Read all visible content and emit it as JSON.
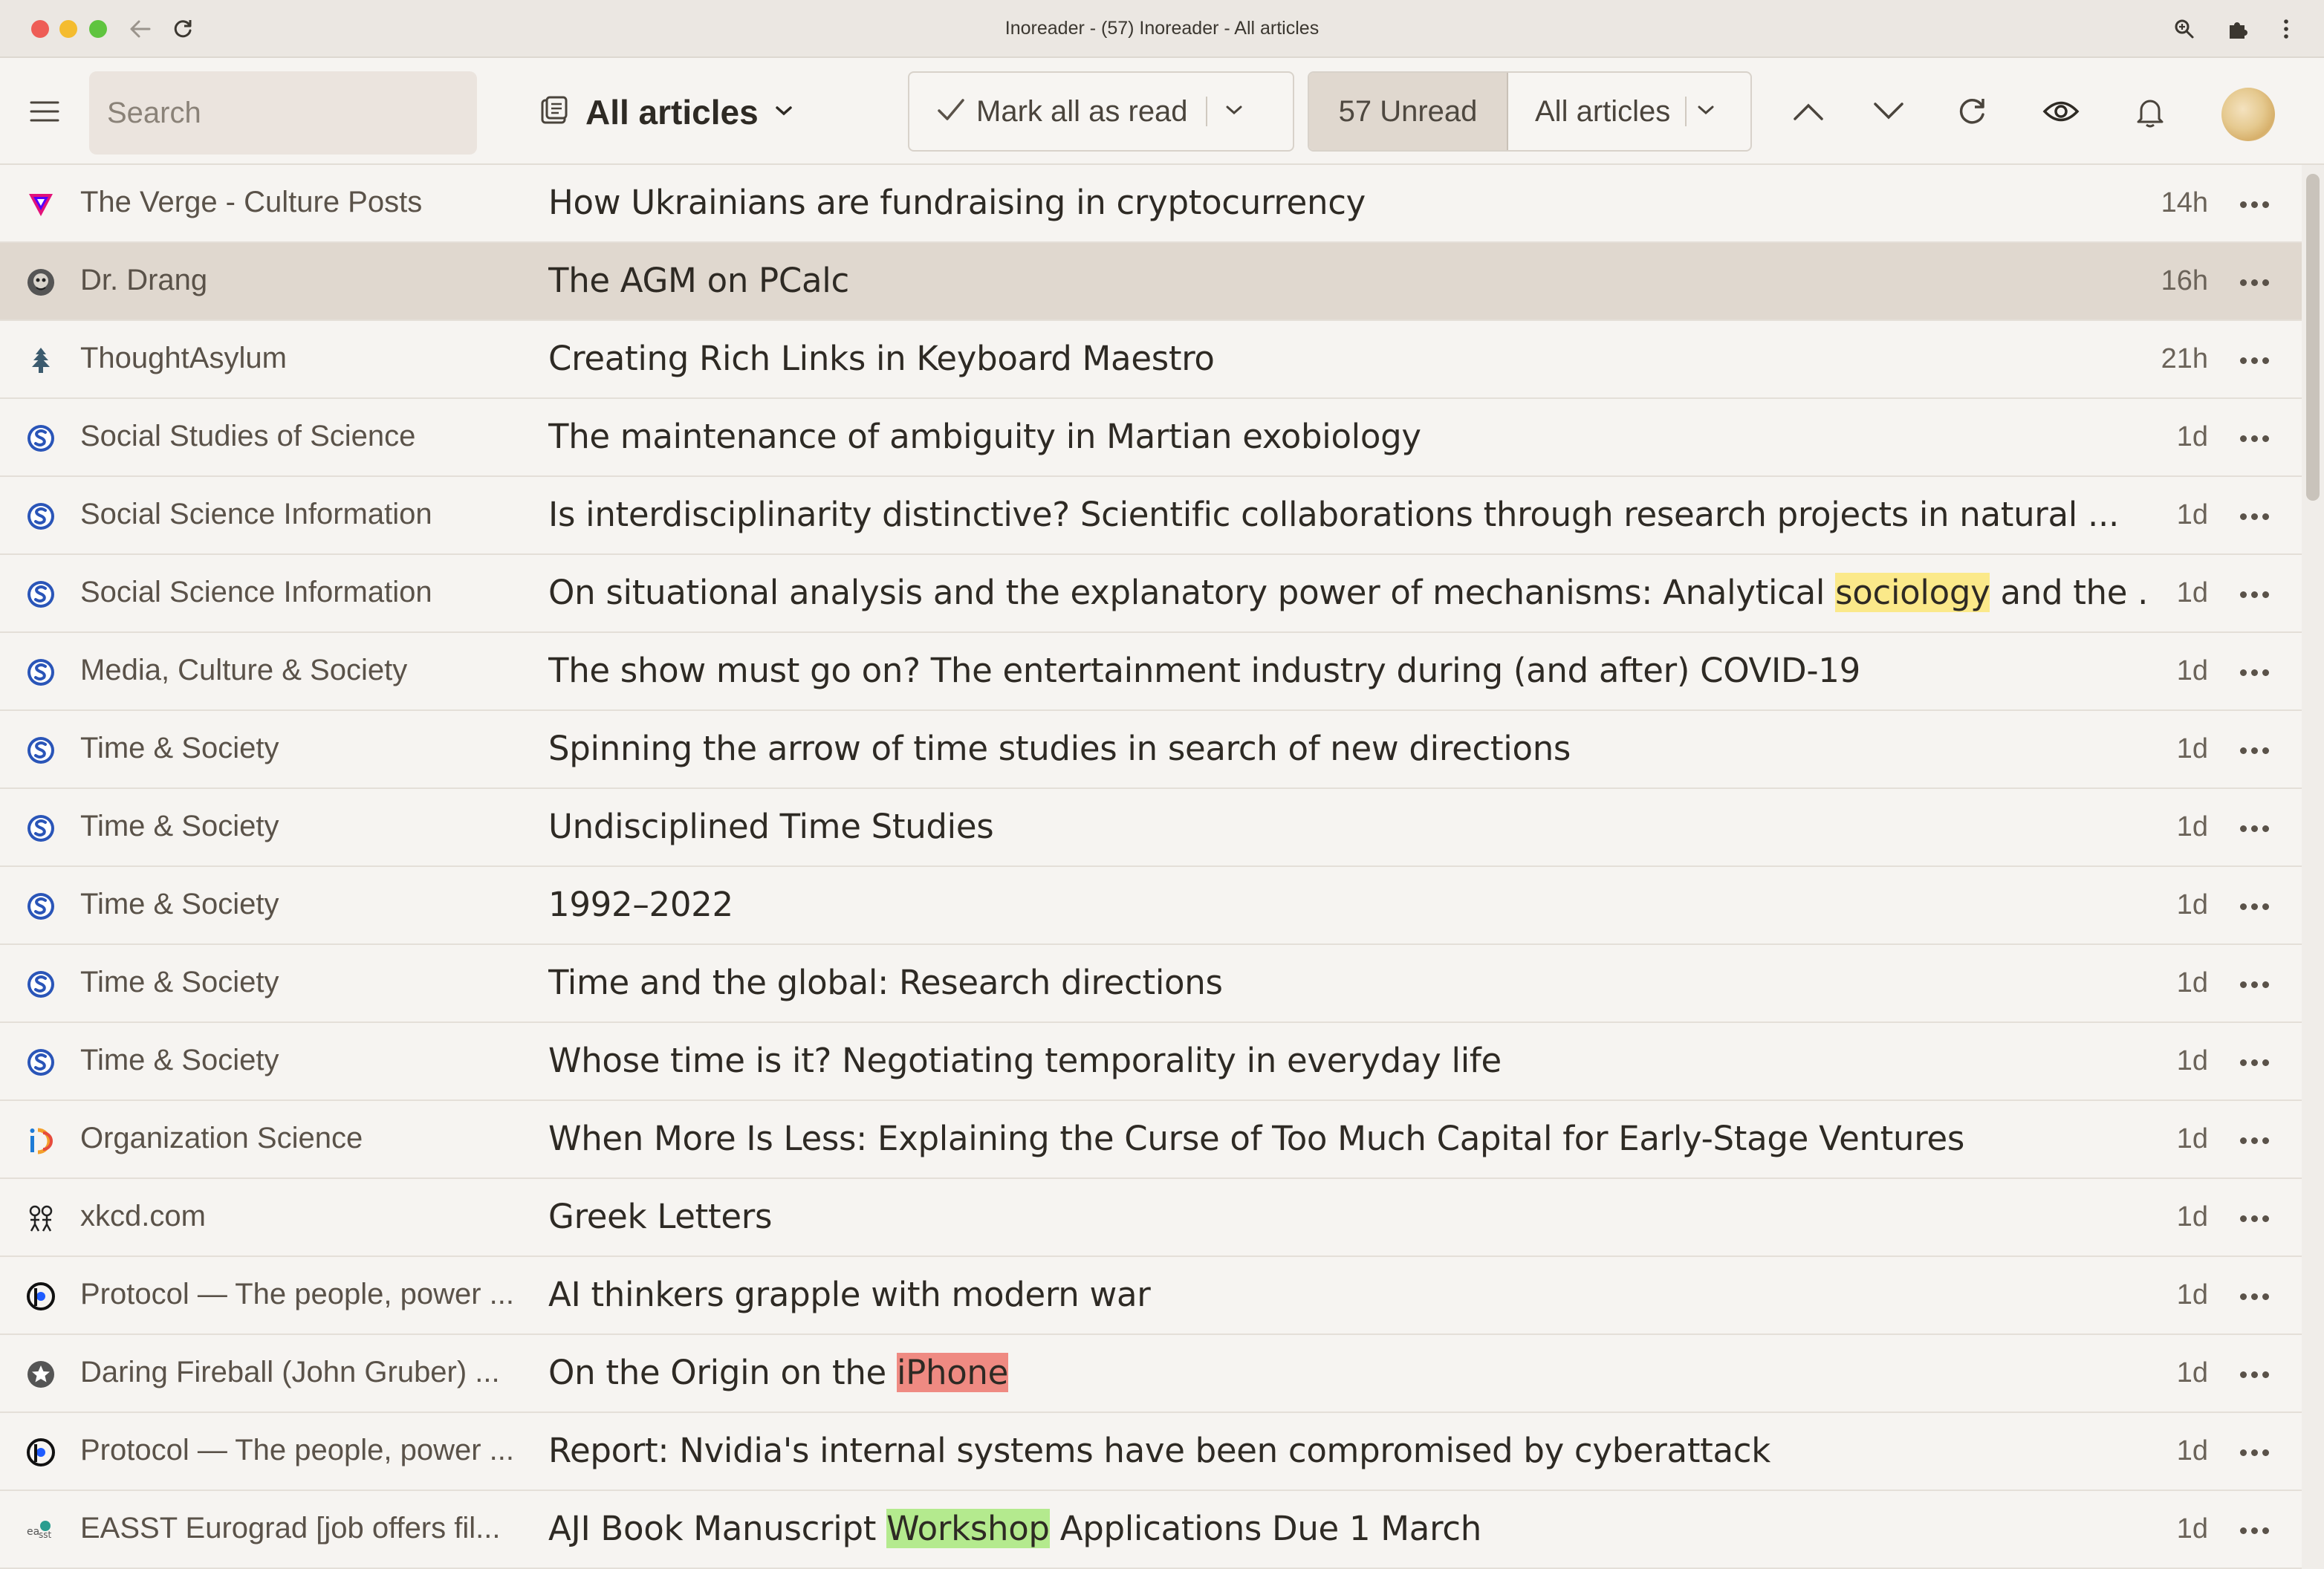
{
  "window": {
    "title": "Inoreader - (57) Inoreader - All articles"
  },
  "toolbar": {
    "search_placeholder": "Search",
    "view_title": "All articles",
    "mark_all_read": "Mark all as read",
    "unread_count": "57 Unread",
    "filter": "All articles"
  },
  "icons": {
    "menu": "hamburger-icon",
    "view": "article-list-icon",
    "prev": "chevron-up-icon",
    "next": "chevron-down-icon",
    "refresh": "refresh-icon",
    "visibility": "eye-icon",
    "notifications": "bell-icon"
  },
  "colors": {
    "selected_row": "#e0d8cf",
    "highlight_yellow": "#fbe98a",
    "highlight_red": "#ef8a82",
    "highlight_green": "#b4ea8e"
  },
  "articles": [
    {
      "feed": "The Verge - Culture Posts",
      "icon": "verge-icon",
      "pre": "How Ukrainians are fundraising in cryptocurrency",
      "hl": "",
      "post": "",
      "age": "14h",
      "selected": false
    },
    {
      "feed": "Dr. Drang",
      "icon": "drang-icon",
      "pre": "The AGM on PCalc",
      "hl": "",
      "post": "",
      "age": "16h",
      "selected": true
    },
    {
      "feed": "ThoughtAsylum",
      "icon": "thoughtasylum-icon",
      "pre": "Creating Rich Links in Keyboard Maestro",
      "hl": "",
      "post": "",
      "age": "21h",
      "selected": false
    },
    {
      "feed": "Social Studies of Science",
      "icon": "sage-icon",
      "pre": "The maintenance of ambiguity in Martian exobiology",
      "hl": "",
      "post": "",
      "age": "1d",
      "selected": false
    },
    {
      "feed": "Social Science Information",
      "icon": "sage-icon",
      "pre": "Is interdisciplinarity distinctive? Scientific collaborations through research projects in natural ...",
      "hl": "",
      "post": "",
      "age": "1d",
      "selected": false
    },
    {
      "feed": "Social Science Information",
      "icon": "sage-icon",
      "pre": "On situational analysis and the explanatory power of mechanisms: Analytical ",
      "hl": "sociology",
      "hl_color": "yellow",
      "post": " and the ...",
      "age": "1d",
      "selected": false
    },
    {
      "feed": "Media, Culture & Society",
      "icon": "sage-icon",
      "pre": "The show must go on? The entertainment industry during (and after) COVID-19",
      "hl": "",
      "post": "",
      "age": "1d",
      "selected": false
    },
    {
      "feed": "Time & Society",
      "icon": "sage-icon",
      "pre": "Spinning the arrow of time studies in search of new directions",
      "hl": "",
      "post": "",
      "age": "1d",
      "selected": false
    },
    {
      "feed": "Time & Society",
      "icon": "sage-icon",
      "pre": "Undisciplined Time Studies",
      "hl": "",
      "post": "",
      "age": "1d",
      "selected": false
    },
    {
      "feed": "Time & Society",
      "icon": "sage-icon",
      "pre": "1992–2022",
      "hl": "",
      "post": "",
      "age": "1d",
      "selected": false
    },
    {
      "feed": "Time & Society",
      "icon": "sage-icon",
      "pre": "Time and the global: Research directions",
      "hl": "",
      "post": "",
      "age": "1d",
      "selected": false
    },
    {
      "feed": "Time & Society",
      "icon": "sage-icon",
      "pre": "Whose time is it? Negotiating temporality in everyday life",
      "hl": "",
      "post": "",
      "age": "1d",
      "selected": false
    },
    {
      "feed": "Organization Science",
      "icon": "informs-icon",
      "pre": "When More Is Less: Explaining the Curse of Too Much Capital for Early-Stage Ventures",
      "hl": "",
      "post": "",
      "age": "1d",
      "selected": false
    },
    {
      "feed": "xkcd.com",
      "icon": "xkcd-icon",
      "pre": "Greek Letters",
      "hl": "",
      "post": "",
      "age": "1d",
      "selected": false
    },
    {
      "feed": "Protocol — The people, power ...",
      "icon": "protocol-icon",
      "pre": "AI thinkers grapple with modern war",
      "hl": "",
      "post": "",
      "age": "1d",
      "selected": false
    },
    {
      "feed": "Daring Fireball (John Gruber) ...",
      "icon": "star-icon",
      "pre": "On the Origin on the ",
      "hl": "iPhone",
      "hl_color": "red",
      "post": "",
      "age": "1d",
      "selected": false
    },
    {
      "feed": "Protocol — The people, power ...",
      "icon": "protocol-icon",
      "pre": "Report: Nvidia's internal systems have been compromised by cyberattack",
      "hl": "",
      "post": "",
      "age": "1d",
      "selected": false
    },
    {
      "feed": "EASST Eurograd [job offers fil...",
      "icon": "easst-icon",
      "pre": "AJI Book Manuscript ",
      "hl": "Workshop",
      "hl_color": "green",
      "post": " Applications Due 1 March",
      "age": "1d",
      "selected": false
    }
  ]
}
